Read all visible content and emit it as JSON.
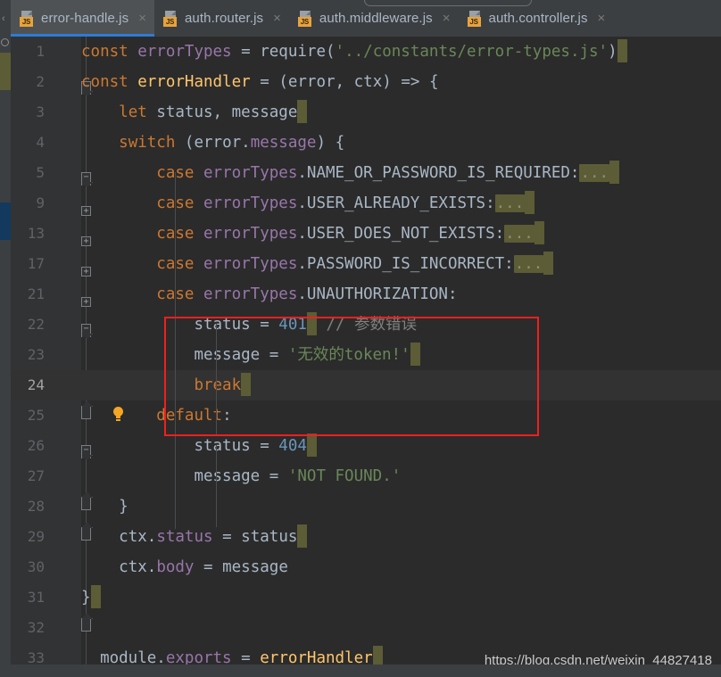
{
  "window": {
    "app": "JetBrains IDE code editor",
    "theme_bg": "#2b2b2b"
  },
  "tabs": [
    {
      "label": "error-handle.js",
      "icon": "js-file-icon",
      "close": "×",
      "active": true
    },
    {
      "label": "auth.router.js",
      "icon": "js-file-icon",
      "close": "×",
      "active": false
    },
    {
      "label": "auth.middleware.js",
      "icon": "js-file-icon",
      "close": "×",
      "active": false
    },
    {
      "label": "auth.controller.js",
      "icon": "js-file-icon",
      "close": "×",
      "active": false
    }
  ],
  "gutter": {
    "line_numbers": [
      "1",
      "2",
      "3",
      "4",
      "5",
      "9",
      "13",
      "17",
      "21",
      "22",
      "23",
      "24",
      "25",
      "26",
      "27",
      "28",
      "29",
      "30",
      "31",
      "32",
      "33"
    ],
    "current_line": "24",
    "bulb_tooltip_icon": "lightbulb-icon"
  },
  "code": {
    "lines": [
      {
        "n": "1",
        "text": "const errorTypes = require('../constants/error-types.js')"
      },
      {
        "n": "2",
        "text": "const errorHandler = (error, ctx) => {"
      },
      {
        "n": "3",
        "text": "    let status, message"
      },
      {
        "n": "4",
        "text": "    switch (error.message) {"
      },
      {
        "n": "5",
        "text": "        case errorTypes.NAME_OR_PASSWORD_IS_REQUIRED:..."
      },
      {
        "n": "9",
        "text": "        case errorTypes.USER_ALREADY_EXISTS:..."
      },
      {
        "n": "13",
        "text": "        case errorTypes.USER_DOES_NOT_EXISTS:..."
      },
      {
        "n": "17",
        "text": "        case errorTypes.PASSWORD_IS_INCORRECT:..."
      },
      {
        "n": "21",
        "text": "        case errorTypes.UNAUTHORIZATION:"
      },
      {
        "n": "22",
        "text": "            status = 401 // 参数错误"
      },
      {
        "n": "23",
        "text": "            message = '无效的token!'"
      },
      {
        "n": "24",
        "text": "            break"
      },
      {
        "n": "25",
        "text": "        default:"
      },
      {
        "n": "26",
        "text": "            status = 404"
      },
      {
        "n": "27",
        "text": "            message = 'NOT FOUND.'"
      },
      {
        "n": "28",
        "text": "    }"
      },
      {
        "n": "29",
        "text": "    ctx.status = status"
      },
      {
        "n": "30",
        "text": "    ctx.body = message"
      },
      {
        "n": "31",
        "text": "}"
      },
      {
        "n": "32",
        "text": ""
      },
      {
        "n": "33",
        "text": "module.exports = errorHandler"
      }
    ],
    "fold_placeholder": "...",
    "comment_22": "// 参数错误",
    "string_23": "'无效的token!'",
    "string_27": "'NOT FOUND.'",
    "string_1": "'../constants/error-types.js'"
  },
  "annotation": {
    "highlight_box_color": "#f01f1f",
    "highlight_lines": [
      "21",
      "22",
      "23",
      "24"
    ]
  },
  "watermark": {
    "text": "https://blog.csdn.net/weixin_44827418"
  },
  "colors": {
    "keyword": "#cc7832",
    "class_name": "#9876aa",
    "function": "#ffc66d",
    "string": "#6a8759",
    "number": "#6897bb",
    "comment": "#808080",
    "identifier": "#a9b7c6",
    "editor_background": "#2b2b2b",
    "gutter_background": "#313335",
    "tabbar_background": "#3c3f41",
    "active_tab_background": "#4e5254",
    "active_tab_underline": "#2d7cd6",
    "fold_background": "#5c5c36"
  }
}
